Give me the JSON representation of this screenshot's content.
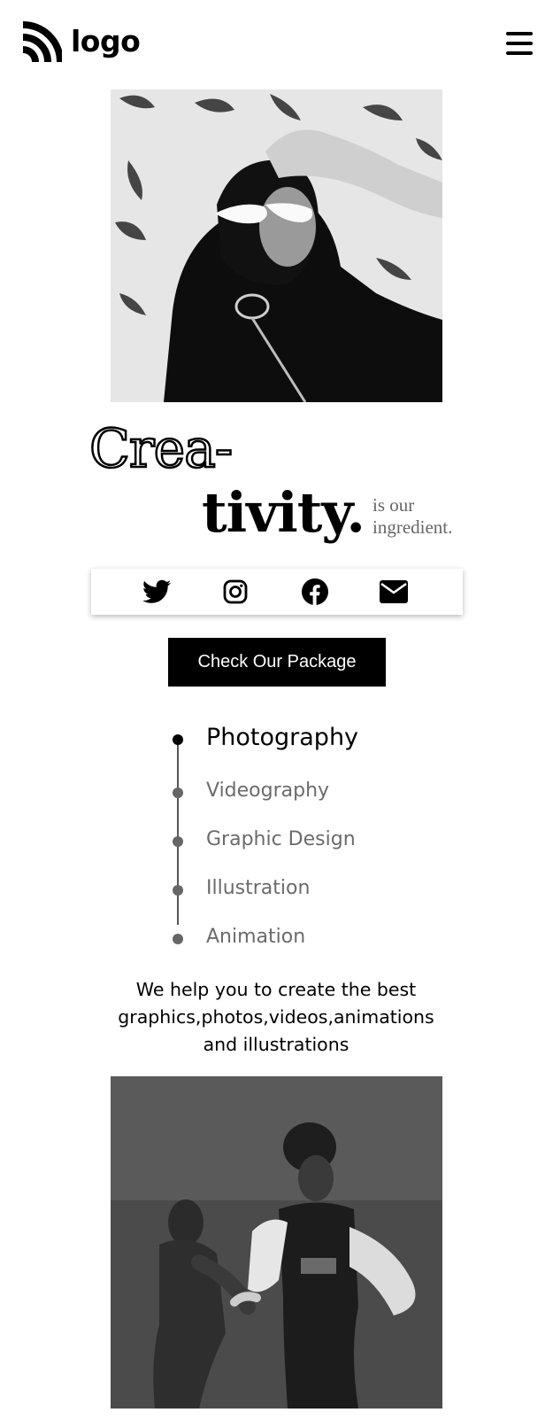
{
  "header": {
    "logo_text": "logo",
    "logo_icon": "wifi-arc-logo-icon",
    "menu_icon": "hamburger-menu-icon"
  },
  "hero": {
    "headline_line1": "Crea-",
    "headline_line2": "tivity.",
    "tagline": "is our ingredient."
  },
  "social": {
    "items": [
      {
        "icon": "twitter-icon"
      },
      {
        "icon": "instagram-icon"
      },
      {
        "icon": "facebook-icon"
      },
      {
        "icon": "envelope-icon"
      }
    ]
  },
  "cta": {
    "label": "Check Our Package"
  },
  "services": {
    "items": [
      {
        "label": "Photography",
        "active": true
      },
      {
        "label": "Videography",
        "active": false
      },
      {
        "label": "Graphic Design",
        "active": false
      },
      {
        "label": "Illustration",
        "active": false
      },
      {
        "label": "Animation",
        "active": false
      }
    ]
  },
  "blurb": "We help you to create the best graphics,photos,videos,animations and illustrations",
  "colors": {
    "background": "#ffffff",
    "primary": "#000000",
    "muted_text": "#6b6b6b",
    "button_text": "#ffffff"
  }
}
